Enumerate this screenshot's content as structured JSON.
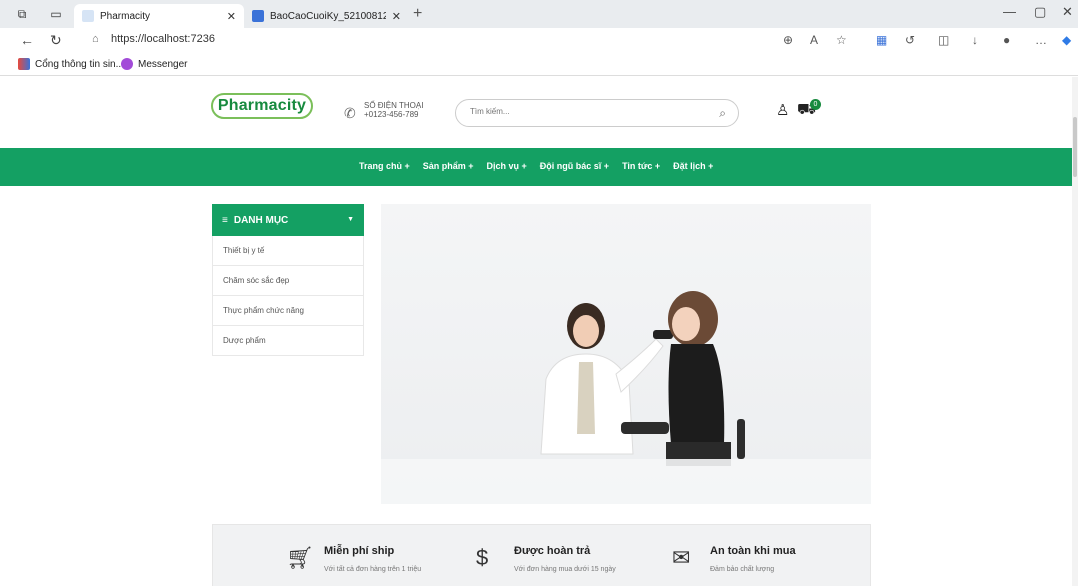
{
  "browser": {
    "tabs": [
      {
        "title": "Pharmacity",
        "active": true
      },
      {
        "title": "BaoCaoCuoiKy_52100812_51900",
        "active": false
      }
    ],
    "url": "https://localhost:7236",
    "bookmarks": [
      "Cổng thông tin sin...",
      "Messenger"
    ]
  },
  "header": {
    "logo": "Pharmacity",
    "phone_label": "SỐ ĐIỆN THOẠI",
    "phone_number": "+0123-456-789",
    "search_placeholder": "Tìm kiếm...",
    "cart_count": "0"
  },
  "menu": [
    "Trang chủ +",
    "Sản phẩm +",
    "Dịch vụ +",
    "Đội ngũ bác sĩ +",
    "Tin tức +",
    "Đặt lịch +"
  ],
  "categories": {
    "title": "DANH MỤC",
    "items": [
      "Thiết bị y tế",
      "Chăm sóc sắc đẹp",
      "Thực phẩm chức năng",
      "Dược phẩm"
    ]
  },
  "features": [
    {
      "title": "Miễn phí ship",
      "subtitle": "Với tất cả đơn hàng trên 1 triệu",
      "icon": "cart-icon"
    },
    {
      "title": "Được hoàn trả",
      "subtitle": "Với đơn hàng mua dưới 15 ngày",
      "icon": "money-bag-icon"
    },
    {
      "title": "An toàn khi mua",
      "subtitle": "Đảm bảo chất lượng",
      "icon": "secure-payment-icon"
    }
  ],
  "colors": {
    "brand_green": "#14a063",
    "logo_border": "#7bbf5a"
  }
}
